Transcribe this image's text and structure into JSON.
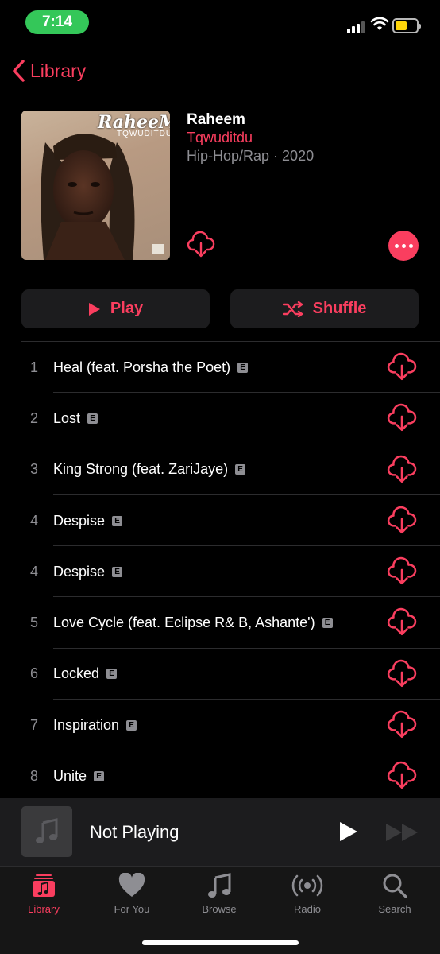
{
  "status_bar": {
    "time": "7:14"
  },
  "nav": {
    "back_label": "Library"
  },
  "album": {
    "art_title": "RaheeM",
    "art_subtitle": "TQWUDITDU",
    "title": "Raheem",
    "artist": "Tqwuditdu",
    "meta": "Hip-Hop/Rap · 2020"
  },
  "actions": {
    "play_label": "Play",
    "shuffle_label": "Shuffle"
  },
  "tracks": [
    {
      "number": "1",
      "title": "Heal (feat. Porsha the Poet)",
      "explicit": "E"
    },
    {
      "number": "2",
      "title": "Lost",
      "explicit": "E"
    },
    {
      "number": "3",
      "title": "King Strong (feat. ZariJaye)",
      "explicit": "E"
    },
    {
      "number": "4",
      "title": "Despise",
      "explicit": "E"
    },
    {
      "number": "4",
      "title": "Despise",
      "explicit": "E"
    },
    {
      "number": "5",
      "title": "Love Cycle (feat. Eclipse R& B, Ashante')",
      "explicit": "E"
    },
    {
      "number": "6",
      "title": "Locked",
      "explicit": "E"
    },
    {
      "number": "7",
      "title": "Inspiration",
      "explicit": "E"
    },
    {
      "number": "8",
      "title": "Unite",
      "explicit": "E"
    }
  ],
  "mini_player": {
    "title": "Not Playing"
  },
  "tabs": [
    {
      "label": "Library",
      "icon": "library-icon"
    },
    {
      "label": "For You",
      "icon": "heart-icon"
    },
    {
      "label": "Browse",
      "icon": "music-note-icon"
    },
    {
      "label": "Radio",
      "icon": "radio-icon"
    },
    {
      "label": "Search",
      "icon": "search-icon"
    }
  ],
  "colors": {
    "accent": "#fa3e5f",
    "status_pill": "#34c759",
    "battery": "#ffd60a",
    "background": "#000000"
  }
}
